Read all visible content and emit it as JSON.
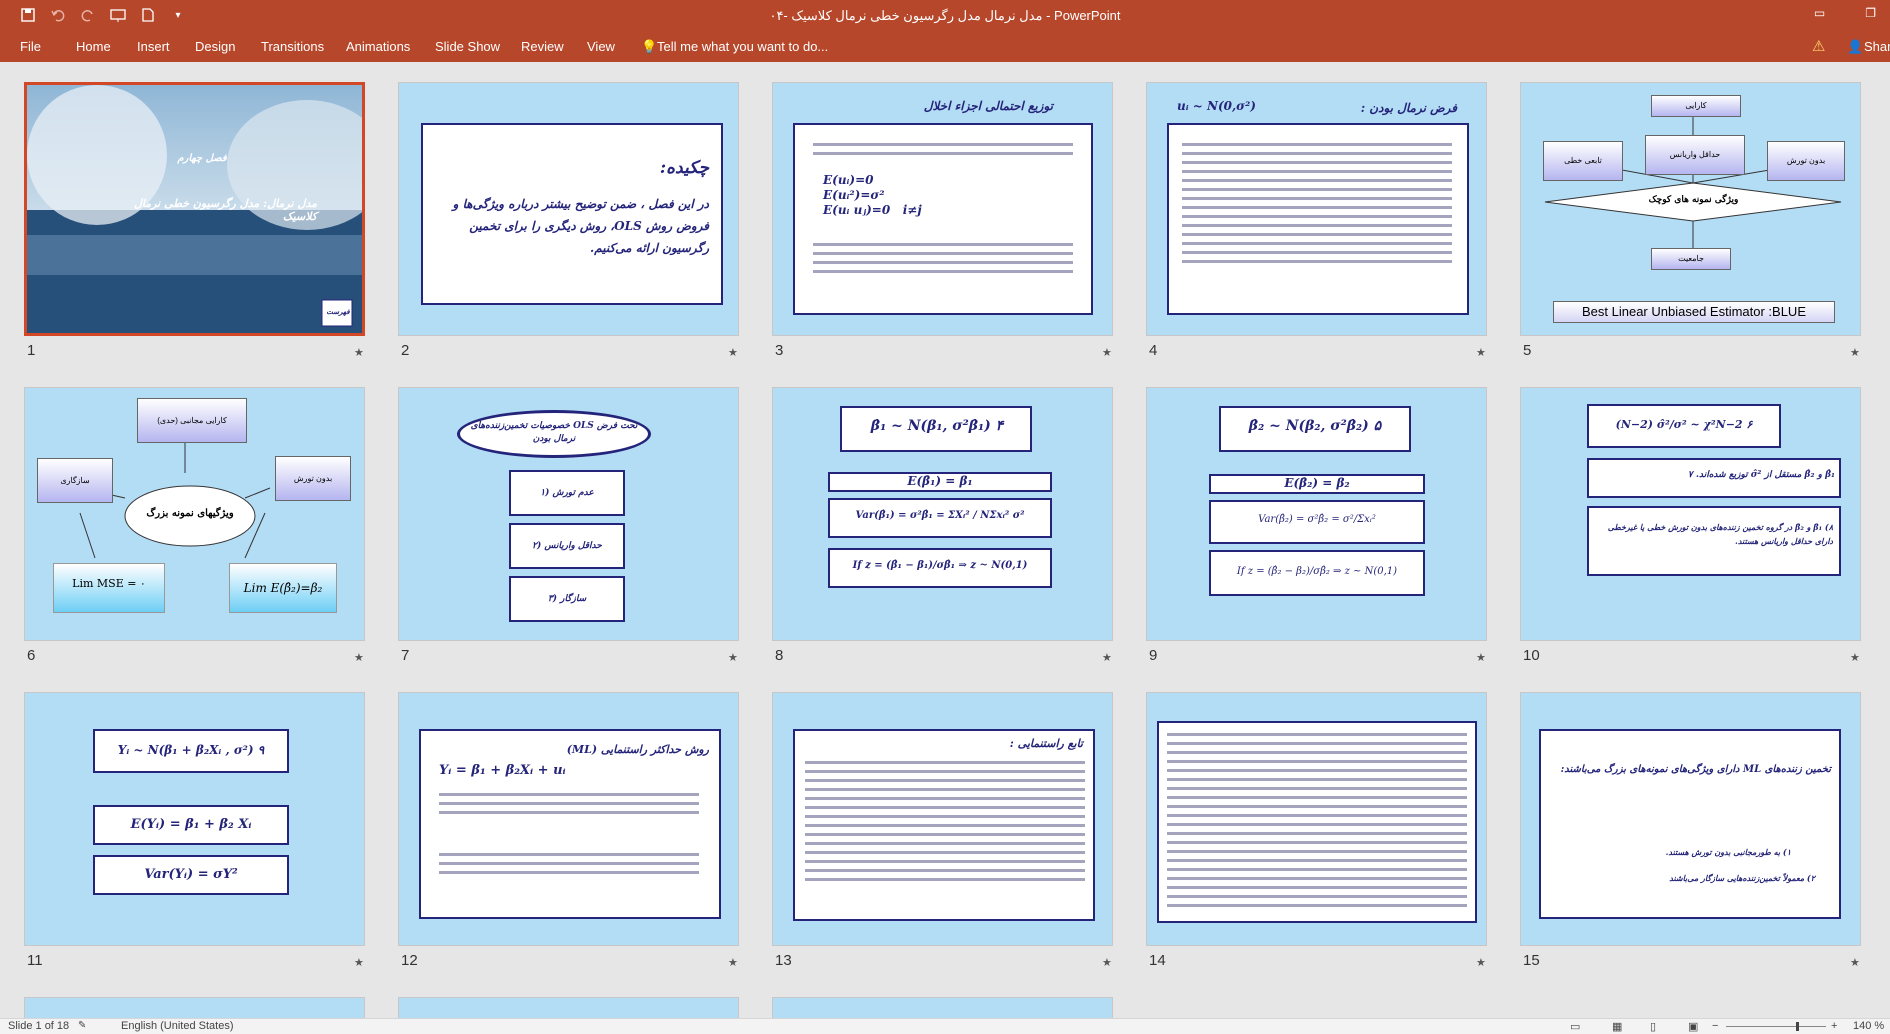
{
  "window": {
    "title": "۰۴- مدل نرمال مدل رگرسیون خطی نرمال کلاسیک - PowerPoint"
  },
  "menu": {
    "file": "File",
    "home": "Home",
    "insert": "Insert",
    "design": "Design",
    "transitions": "Transitions",
    "animations": "Animations",
    "slideshow": "Slide Show",
    "review": "Review",
    "view": "View",
    "tell_me": "Tell me what you want to do...",
    "share": "Share"
  },
  "slides": [
    {
      "num": "1",
      "title": "مدل نرمال: مدل رگرسیون خطی نرمال کلاسیک",
      "subtitle": "فصل چهارم",
      "button": "فهرست"
    },
    {
      "num": "2",
      "title": "چکیده:",
      "body": "در این فصل ، ضمن توضیح بیشتر درباره ویژگی‌ها و فروض روش OLS، روش دیگری را برای تخمین رگرسیون ارائه می‌کنیم."
    },
    {
      "num": "3",
      "title": "توزیع احتمالی اجزاء اخلال"
    },
    {
      "num": "4",
      "title": "فرض نرمال بودن :",
      "formula": "uᵢ ~ N(0,σ²)"
    },
    {
      "num": "5",
      "boxes": [
        "کارایی",
        "تابعی خطی",
        "حداقل واریانس",
        "بدون تورش",
        "ویژگی نمونه های کوچک",
        "جامعیت"
      ],
      "blue": "Best Linear  Unbiased Estimator :BLUE"
    },
    {
      "num": "6",
      "boxes": [
        "کارایی مجانبی (حدی)",
        "سازگاری",
        "بدون تورش",
        "ویژگیهای نمونه بزرگ"
      ],
      "lim": "Lim   MSE   = ۰"
    },
    {
      "num": "7",
      "title": "خصوصیات تخمین‌زننده‌های OLS تحت فرض نرمال بودن",
      "items": [
        "۱) عدم تورش",
        "۲) حداقل واریانس",
        "۳) سازگار"
      ]
    },
    {
      "num": "8",
      "formula": "β̂₁ ~ N(β₁, σ²β̂₁)   ۴",
      "e": "E(β̂₁) = β₁",
      "v": "Var(β̂₁) = σ²β̂₁ = ΣXᵢ² / NΣxᵢ² σ²",
      "z": "If  z = (β̂₁ − β₁)/σβ̂₁ ⇒ z ~ N(0,1)"
    },
    {
      "num": "9",
      "formula": "β̂₂ ~ N(β₂, σ²β̂₂)   ۵",
      "e": "E(β̂₂) = β₂",
      "v": "Var(β̂₂) = σ²β̂₂ = σ²/Σxᵢ²",
      "z": "If  z = (β̂₂ − β₂)/σβ̂₂ ⇒ z ~ N(0,1)"
    },
    {
      "num": "10",
      "f1": "(N−2) σ̂²/σ² ~ χ²N−2   ۶",
      "f2": "β̂₁ و β̂₂ مستقل از σ̂² توزیع شده‌اند.   ۷",
      "f3": "۸) β̂₁ و β̂₂ در گروه تخمین زننده‌های بدون تورش خطی یا غیرخطی دارای حداقل واریانس هستند."
    },
    {
      "num": "11",
      "f1": "Yᵢ ~ N(β₁ + β₂Xᵢ , σ²)   ۹",
      "f2": "E(Yᵢ) = β₁ + β₂ Xᵢ",
      "f3": "Var(Yᵢ) = σY²"
    },
    {
      "num": "12",
      "title": "روش حداکثر راستنمایی (ML)",
      "eq": "Yᵢ = β₁ + β₂Xᵢ + uᵢ"
    },
    {
      "num": "13",
      "title": "تابع راستنمایی :"
    },
    {
      "num": "14"
    },
    {
      "num": "15",
      "title": "تخمین زننده‌های ML دارای ویژگی‌های نمونه‌های بزرگ می‌باشند:",
      "items": [
        "۱) به طورمجانبی بدون تورش هستند.",
        "۲) معمولاً تخمین‌زننده‌هایی سازگار می‌باشند"
      ]
    }
  ],
  "status": {
    "slide": "Slide 1 of 18",
    "language": "English (United States)",
    "zoom": "140 %"
  }
}
